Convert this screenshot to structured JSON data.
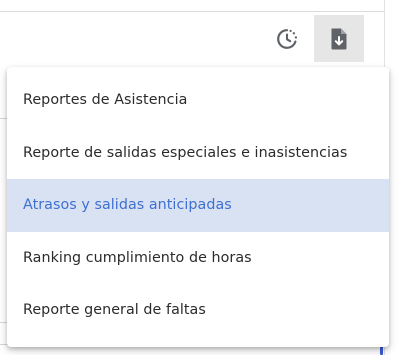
{
  "toolbar": {
    "history_icon": "history-clock-icon",
    "download_icon": "file-download-icon"
  },
  "menu": {
    "items": [
      {
        "label": "Reportes de Asistencia"
      },
      {
        "label": "Reporte de salidas especiales e inasistencias"
      },
      {
        "label": "Atrasos y salidas anticipadas",
        "highlighted": true
      },
      {
        "label": "Ranking cumplimiento de horas"
      },
      {
        "label": "Reporte general de faltas"
      }
    ]
  },
  "colors": {
    "highlight_bg": "#d9e2f3",
    "highlight_text": "#3f6fd1",
    "text": "#2b2b2b",
    "active_button_bg": "#e6e6e6",
    "icon": "#5f6368"
  }
}
